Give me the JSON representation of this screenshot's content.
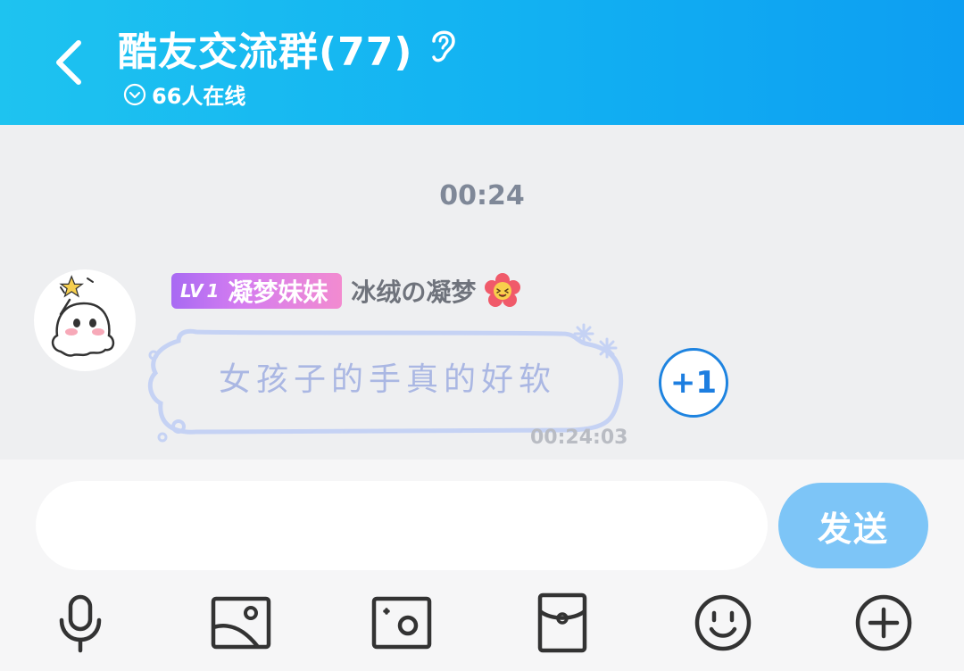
{
  "header": {
    "title": "酷友交流群(77)",
    "online_count": "66人在线"
  },
  "chat": {
    "time_divider": "00:24",
    "messages": [
      {
        "level_prefix": "LV",
        "level_num": "1",
        "member_title": "凝梦妹妹",
        "nickname": "冰绒の凝梦",
        "text": "女孩子的手真的好软",
        "time": "00:24:03",
        "plus_one": "+1"
      }
    ]
  },
  "input": {
    "value": "",
    "placeholder": "",
    "send_label": "发送"
  },
  "toolbar": {
    "icons": [
      "microphone-icon",
      "image-icon",
      "camera-icon",
      "red-packet-icon",
      "emoji-icon",
      "plus-icon"
    ]
  },
  "colors": {
    "header_start": "#1ec3f0",
    "header_end": "#0d9ef2",
    "send_button": "#7dc5f7",
    "plus_one": "#1d7ee0",
    "badge_start": "#a86af3",
    "badge_end": "#f28bd0"
  }
}
